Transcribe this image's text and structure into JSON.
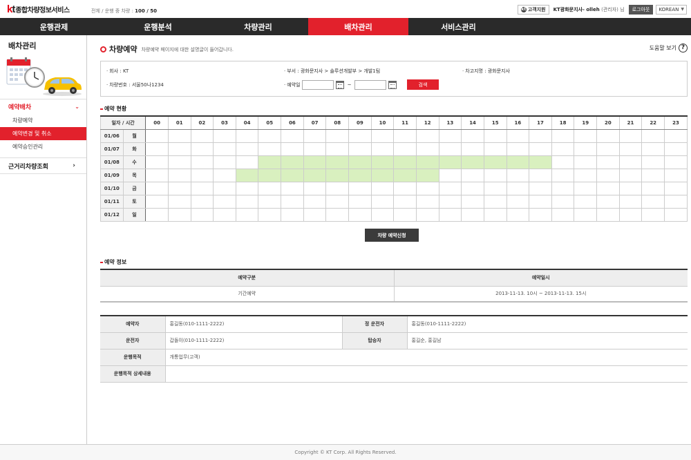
{
  "header": {
    "logo_kt_k": "k",
    "logo_kt_t": "t",
    "logo_service": "종합차량정보서비스",
    "vehicle_count_label": "전체 / 운행 중 차량 :",
    "vehicle_count_value": "100 / 50",
    "support_label": "고객지원",
    "support_icon": "kt",
    "user_name": "KT광화문지사- olleh",
    "user_role": "(관리자) 님",
    "logout_label": "로그아웃",
    "language": "KOREAN",
    "language_caret": "▼"
  },
  "nav": {
    "items": [
      {
        "label": "운행관제"
      },
      {
        "label": "운행분석"
      },
      {
        "label": "차량관리"
      },
      {
        "label": "배차관리"
      },
      {
        "label": "서비스관리"
      }
    ],
    "active_index": 3
  },
  "sidebar": {
    "title": "배차관리",
    "illustration": "calendar-clock-car-illustration",
    "group_label": "예약배차",
    "group_chevron": "⌄",
    "items": [
      {
        "label": "차량예약"
      },
      {
        "label": "예약변경 및 취소"
      },
      {
        "label": "예약승인관리"
      }
    ],
    "active_item": 1,
    "group2_label": "근거리차량조회",
    "group2_chevron": "›"
  },
  "page": {
    "title": "차량예약",
    "description": "차량예약 페이지에 대한 설명글이 들어갑니다.",
    "help_label": "도움말 보기",
    "help_icon": "?"
  },
  "search": {
    "dot": "·",
    "company_label": "회사 :",
    "company_value": "KT",
    "dept_label": "부서 :",
    "dept_value": "광화문지사 > 솔루션개발부 > 개발1팀",
    "garage_label": "차고지명 :",
    "garage_value": "광화문지사",
    "plate_label": "차량번호 :",
    "plate_value": "서울50나1234",
    "date_label": "예약일",
    "date_from": "",
    "date_to": "",
    "tilde": "~",
    "search_button": "검색"
  },
  "schedule": {
    "section_title": "예약 현황",
    "header_datetime": "일자 / 시간",
    "hours": [
      "00",
      "01",
      "02",
      "03",
      "04",
      "05",
      "06",
      "07",
      "08",
      "09",
      "10",
      "11",
      "12",
      "13",
      "14",
      "15",
      "16",
      "17",
      "18",
      "19",
      "20",
      "21",
      "22",
      "23"
    ],
    "rows": [
      {
        "date": "01/06",
        "day": "월",
        "booked": []
      },
      {
        "date": "01/07",
        "day": "화",
        "booked": []
      },
      {
        "date": "01/08",
        "day": "수",
        "booked": [
          5,
          6,
          7,
          8,
          9,
          10,
          11,
          12,
          13,
          14,
          15,
          16,
          17
        ]
      },
      {
        "date": "01/09",
        "day": "목",
        "booked": [
          4,
          5,
          6,
          7,
          8,
          9,
          10,
          11,
          12
        ]
      },
      {
        "date": "01/10",
        "day": "금",
        "booked": []
      },
      {
        "date": "01/11",
        "day": "토",
        "booked": []
      },
      {
        "date": "01/12",
        "day": "일",
        "booked": []
      }
    ],
    "apply_button": "차량 예약신청"
  },
  "reservation": {
    "section_title": "예약 정보",
    "col_type": "예약구분",
    "col_datetime": "예약일시",
    "type_value": "기간예약",
    "datetime_value": "2013-11-13. 10시 ~ 2013-11-13. 15시"
  },
  "details": {
    "booker_label": "예약자",
    "booker_value": "홍길동(010-1111-2222)",
    "main_driver_label": "정 운전자",
    "main_driver_value": "홍길동(010-1111-2222)",
    "driver_label": "운전자",
    "driver_value": "갑돌이(010-1111-2222)",
    "passenger_label": "탑승자",
    "passenger_value": "홍길순, 홍길남",
    "purpose_label": "운행목적",
    "purpose_value": "개통업무(고객)",
    "purpose_detail_label": "운행목적 상세내용",
    "purpose_detail_value": ""
  },
  "footer": {
    "copyright": "Copyright © KT Corp. All Rights Reserved."
  }
}
